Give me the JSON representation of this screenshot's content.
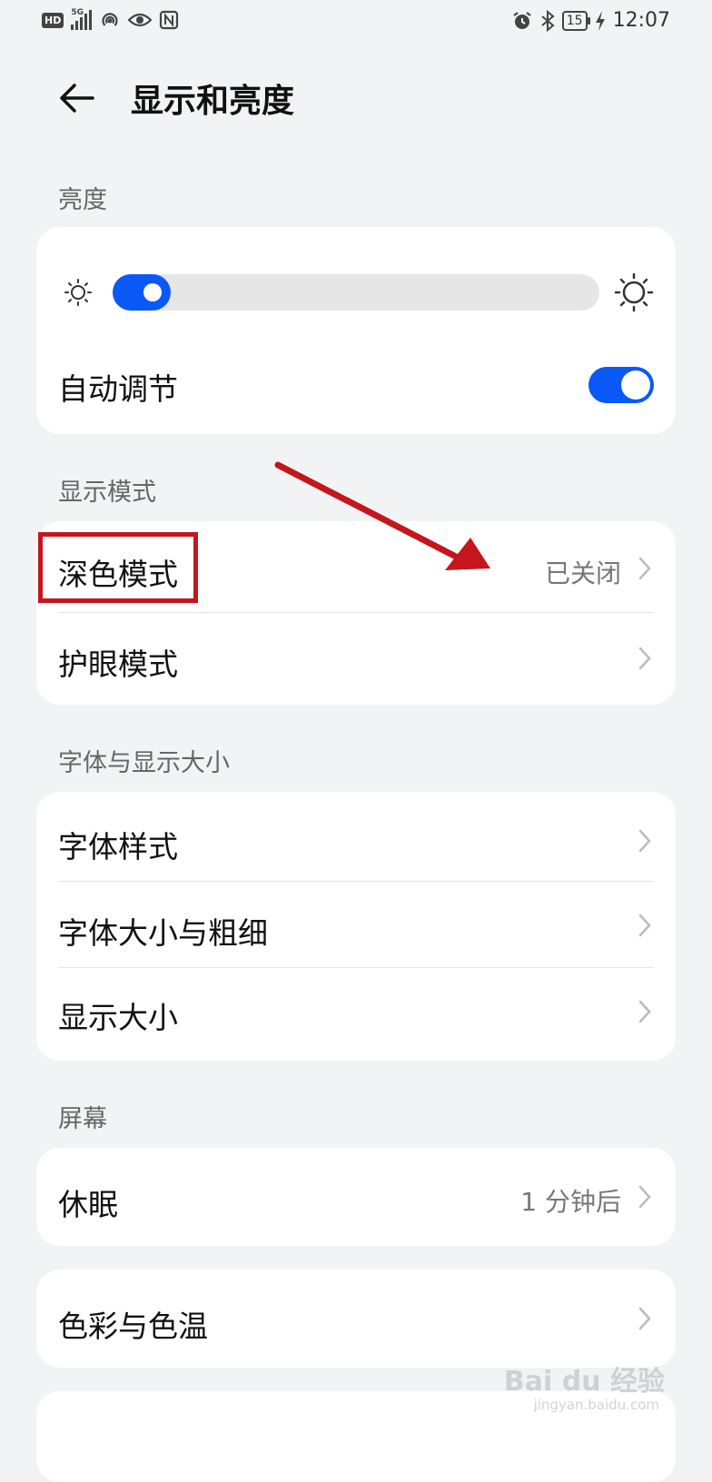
{
  "status_bar": {
    "left_icons": [
      "hd-icon",
      "5g-signal-icon",
      "hotspot-icon",
      "eye-comfort-icon",
      "nfc-icon"
    ],
    "hd_label": "HD",
    "network_label": "5G",
    "right_icons": [
      "alarm-icon",
      "bluetooth-icon",
      "battery-icon",
      "charging-icon"
    ],
    "battery_level": "15",
    "time": "12:07"
  },
  "header": {
    "title": "显示和亮度"
  },
  "sections": {
    "brightness": {
      "label": "亮度",
      "slider_level": 0.12,
      "auto_adjust_label": "自动调节",
      "auto_adjust_on": true
    },
    "display_mode": {
      "label": "显示模式",
      "dark_mode_label": "深色模式",
      "dark_mode_value": "已关闭",
      "eye_comfort_label": "护眼模式"
    },
    "font_display": {
      "label": "字体与显示大小",
      "font_style_label": "字体样式",
      "font_size_weight_label": "字体大小与粗细",
      "display_size_label": "显示大小"
    },
    "screen": {
      "label": "屏幕",
      "sleep_label": "休眠",
      "sleep_value": "1 分钟后",
      "color_temp_label": "色彩与色温"
    }
  },
  "watermark": {
    "text": "Bai du 经验",
    "sub": "jingyan.baidu.com"
  },
  "colors": {
    "accent": "#0a59f7",
    "annotation": "#c4161c",
    "background": "#f1f3f5"
  }
}
